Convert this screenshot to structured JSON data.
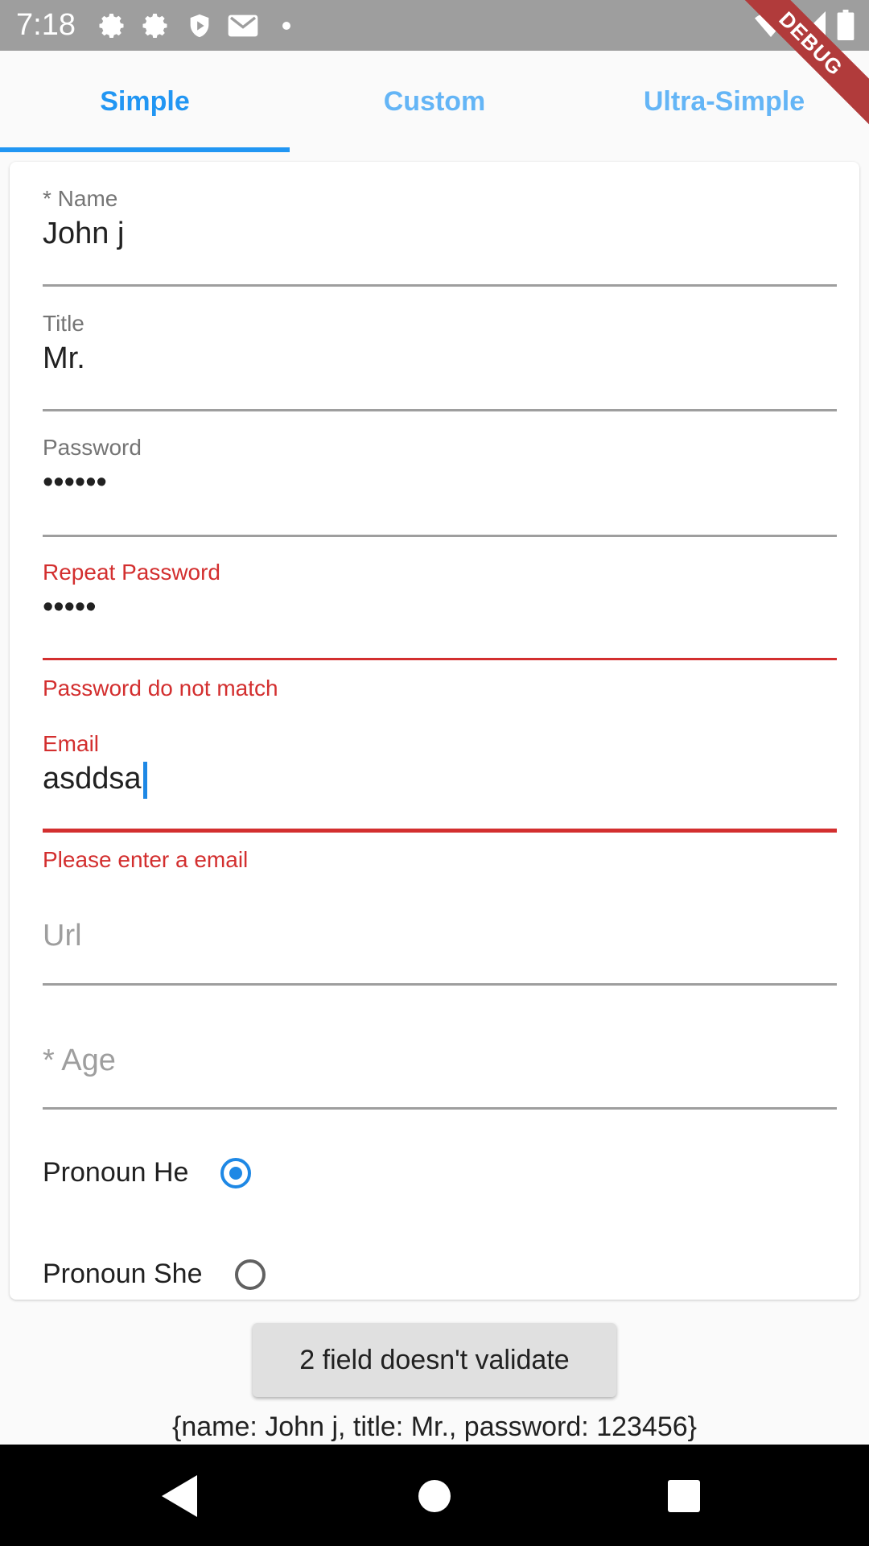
{
  "status_bar": {
    "time": "7:18",
    "icons": [
      "settings-icon",
      "settings-icon",
      "shield-icon",
      "gmail-icon",
      "dot-icon"
    ],
    "right_icons": [
      "wifi-icon",
      "signal-icon",
      "battery-icon"
    ]
  },
  "debug_banner": "DEBUG",
  "tabs": [
    {
      "label": "Simple",
      "active": true
    },
    {
      "label": "Custom",
      "active": false
    },
    {
      "label": "Ultra-Simple",
      "active": false
    }
  ],
  "form": {
    "name": {
      "label": "* Name",
      "value": "John j"
    },
    "title": {
      "label": "Title",
      "value": "Mr."
    },
    "password": {
      "label": "Password",
      "value": "••••••"
    },
    "repeat_password": {
      "label": "Repeat Password",
      "value": "•••••",
      "error": "Password do not match"
    },
    "email": {
      "label": "Email",
      "value": "asddsa",
      "error": "Please enter a email"
    },
    "url": {
      "placeholder": "Url"
    },
    "age": {
      "placeholder": "* Age"
    },
    "pronoun_he": {
      "label": "Pronoun He",
      "selected": true
    },
    "pronoun_she": {
      "label": "Pronoun She",
      "selected": false
    }
  },
  "validate_button": "2 field doesn't validate",
  "result": "{name: John j, title: Mr., password: 123456}",
  "colors": {
    "primary": "#2196f3",
    "error": "#d32f2f",
    "status_bar": "#9e9e9e"
  }
}
